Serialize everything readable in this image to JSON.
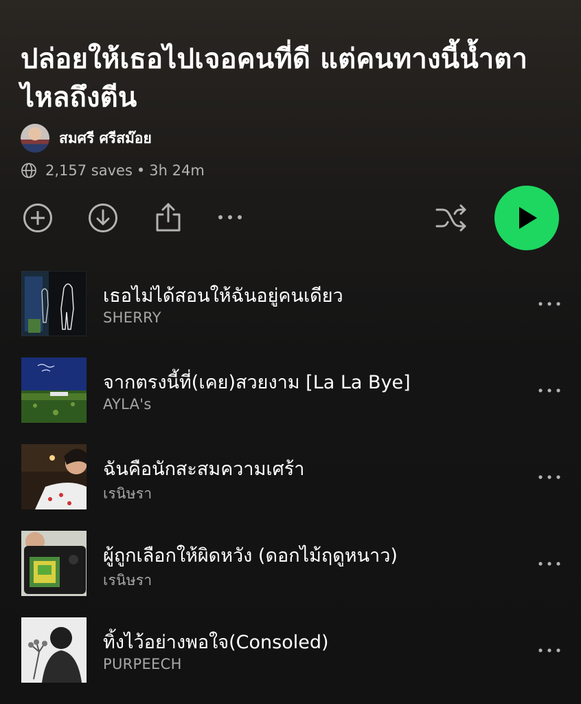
{
  "playlist": {
    "title": "ปล่อยให้เธอไปเจอคนที่ดี แต่คนทางนี้น้ำตาไหลถึงตีน",
    "owner": "สมศรี ศรีสม๊อย",
    "saves": "2,157 saves",
    "separator": "•",
    "duration": "3h 24m"
  },
  "icons": {
    "visibility": "globe-icon",
    "add": "add-circle-icon",
    "download": "download-icon",
    "share": "share-icon",
    "more": "more-horizontal-icon",
    "shuffle": "shuffle-icon",
    "play": "play-icon"
  },
  "colors": {
    "accent": "#1ed760",
    "background": "#121212",
    "secondary_text": "#a7a7a7"
  },
  "tracks": [
    {
      "title": "เธอไม่ได้สอนให้ฉันอยู่คนเดียว",
      "artist": "SHERRY"
    },
    {
      "title": "จากตรงนี้ที่(เคย)สวยงาม [La La Bye]",
      "artist": "AYLA's"
    },
    {
      "title": "ฉันคือนักสะสมความเศร้า",
      "artist": "เรนิษรา"
    },
    {
      "title": "ผู้ถูกเลือกให้ผิดหวัง (ดอกไม้ฤดูหนาว)",
      "artist": "เรนิษรา"
    },
    {
      "title": "ทิ้งไว้อย่างพอใจ(Consoled)",
      "artist": "PURPEECH"
    }
  ]
}
